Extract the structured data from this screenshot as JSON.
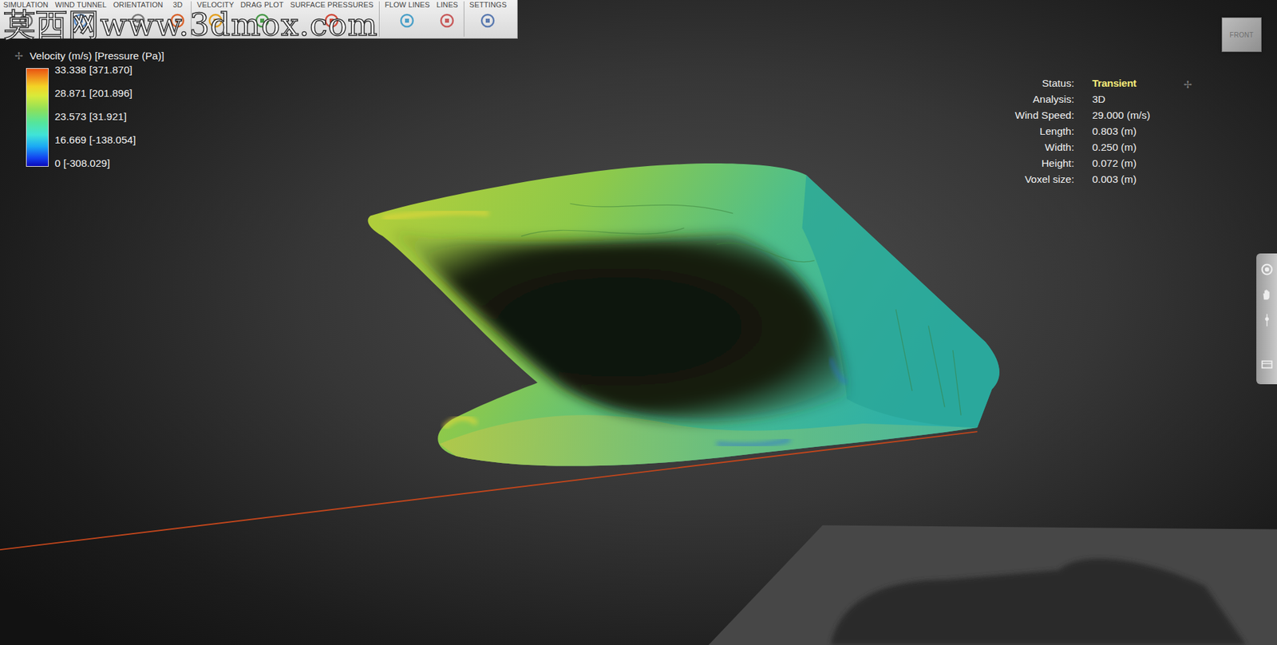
{
  "toolbar": {
    "tabs": [
      {
        "label": "SIMULATION"
      },
      {
        "label": "WIND TUNNEL"
      },
      {
        "label": "ORIENTATION"
      },
      {
        "label": "3D"
      },
      {
        "label": "VELOCITY"
      },
      {
        "label": "DRAG PLOT"
      },
      {
        "label": "SURFACE PRESSURES"
      },
      {
        "label": "FLOW LINES"
      },
      {
        "label": "LINES"
      },
      {
        "label": "SETTINGS"
      }
    ]
  },
  "watermark": "莫西网www.3dmox.com",
  "legend": {
    "move_icon": "✢",
    "title": "Velocity (m/s) [Pressure (Pa)]",
    "stops": [
      {
        "label": "33.338 [371.870]"
      },
      {
        "label": "28.871 [201.896]"
      },
      {
        "label": "23.573 [31.921]"
      },
      {
        "label": "16.669 [-138.054]"
      },
      {
        "label": "0 [-308.029]"
      }
    ]
  },
  "info": {
    "move_icon": "✢",
    "rows": [
      {
        "label": "Status:",
        "value": "Transient",
        "kind": "highlight"
      },
      {
        "label": "Analysis:",
        "value": "3D",
        "kind": "plain"
      },
      {
        "label": "Wind Speed:",
        "value": "29.000 (m/s)",
        "kind": "plain"
      },
      {
        "label": "Length:",
        "value": "0.803 (m)",
        "kind": "plain"
      },
      {
        "label": "Width:",
        "value": "0.250 (m)",
        "kind": "plain"
      },
      {
        "label": "Height:",
        "value": "0.072 (m)",
        "kind": "plain"
      },
      {
        "label": "Voxel size:",
        "value": "0.003 (m)",
        "kind": "plain"
      }
    ]
  },
  "view_cube": {
    "label": "FRONT"
  }
}
